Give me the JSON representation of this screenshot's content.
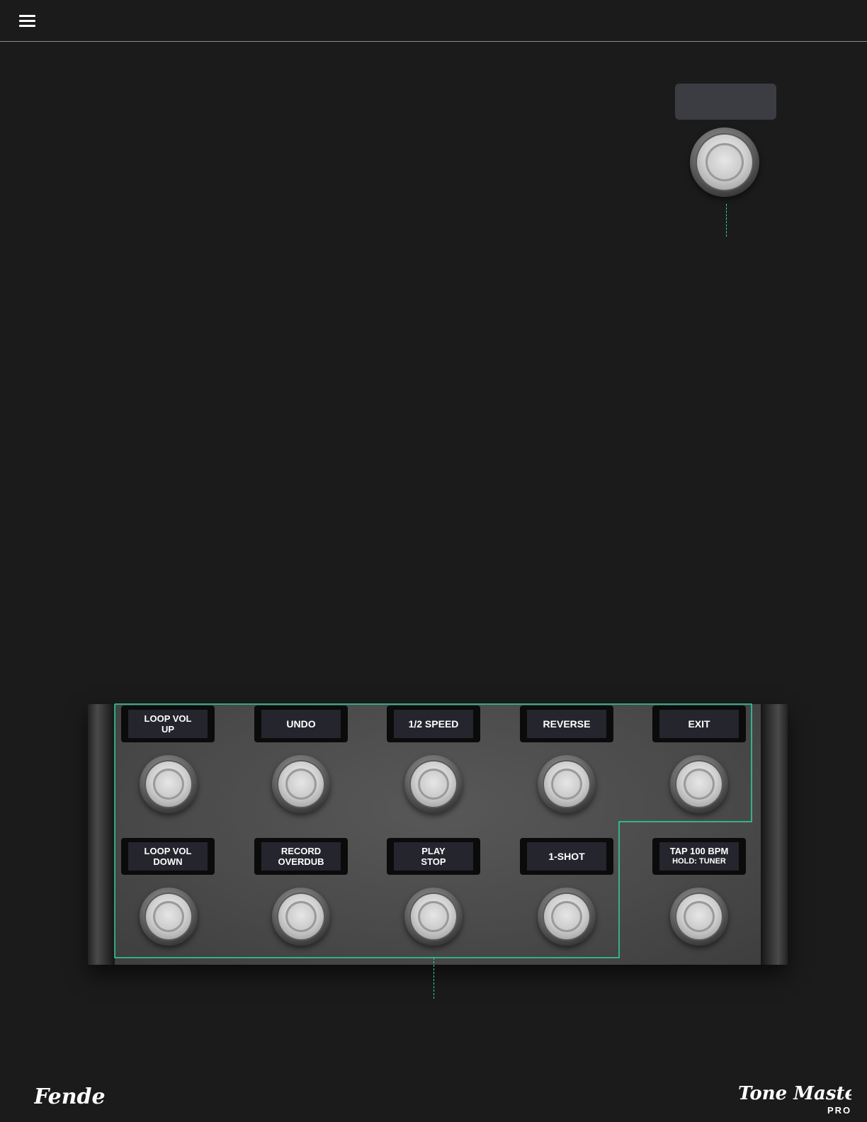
{
  "header": {
    "menu_icon": "hamburger-menu-icon"
  },
  "external_switch": {
    "display_text": ""
  },
  "footswitches": {
    "top_row": [
      {
        "lines": [
          "LOOP VOL",
          "UP"
        ]
      },
      {
        "lines": [
          "UNDO"
        ]
      },
      {
        "lines": [
          "1/2 SPEED"
        ]
      },
      {
        "lines": [
          "REVERSE"
        ]
      },
      {
        "lines": [
          "EXIT"
        ]
      }
    ],
    "bottom_row": [
      {
        "lines": [
          "LOOP VOL",
          "DOWN"
        ]
      },
      {
        "lines": [
          "RECORD",
          "OVERDUB"
        ]
      },
      {
        "lines": [
          "PLAY",
          "STOP"
        ]
      },
      {
        "lines": [
          "1-SHOT"
        ]
      },
      {
        "lines": [
          "TAP 100 BPM",
          "HOLD: TUNER"
        ]
      }
    ]
  },
  "branding": {
    "fender_logo_text": "Fender",
    "tonemaster_logo_text": "Tone Master",
    "tonemaster_sub": "PRO"
  },
  "colors": {
    "background": "#1b1b1b",
    "accent_outline": "#2fd3a0",
    "label_bg": "#24252d"
  }
}
